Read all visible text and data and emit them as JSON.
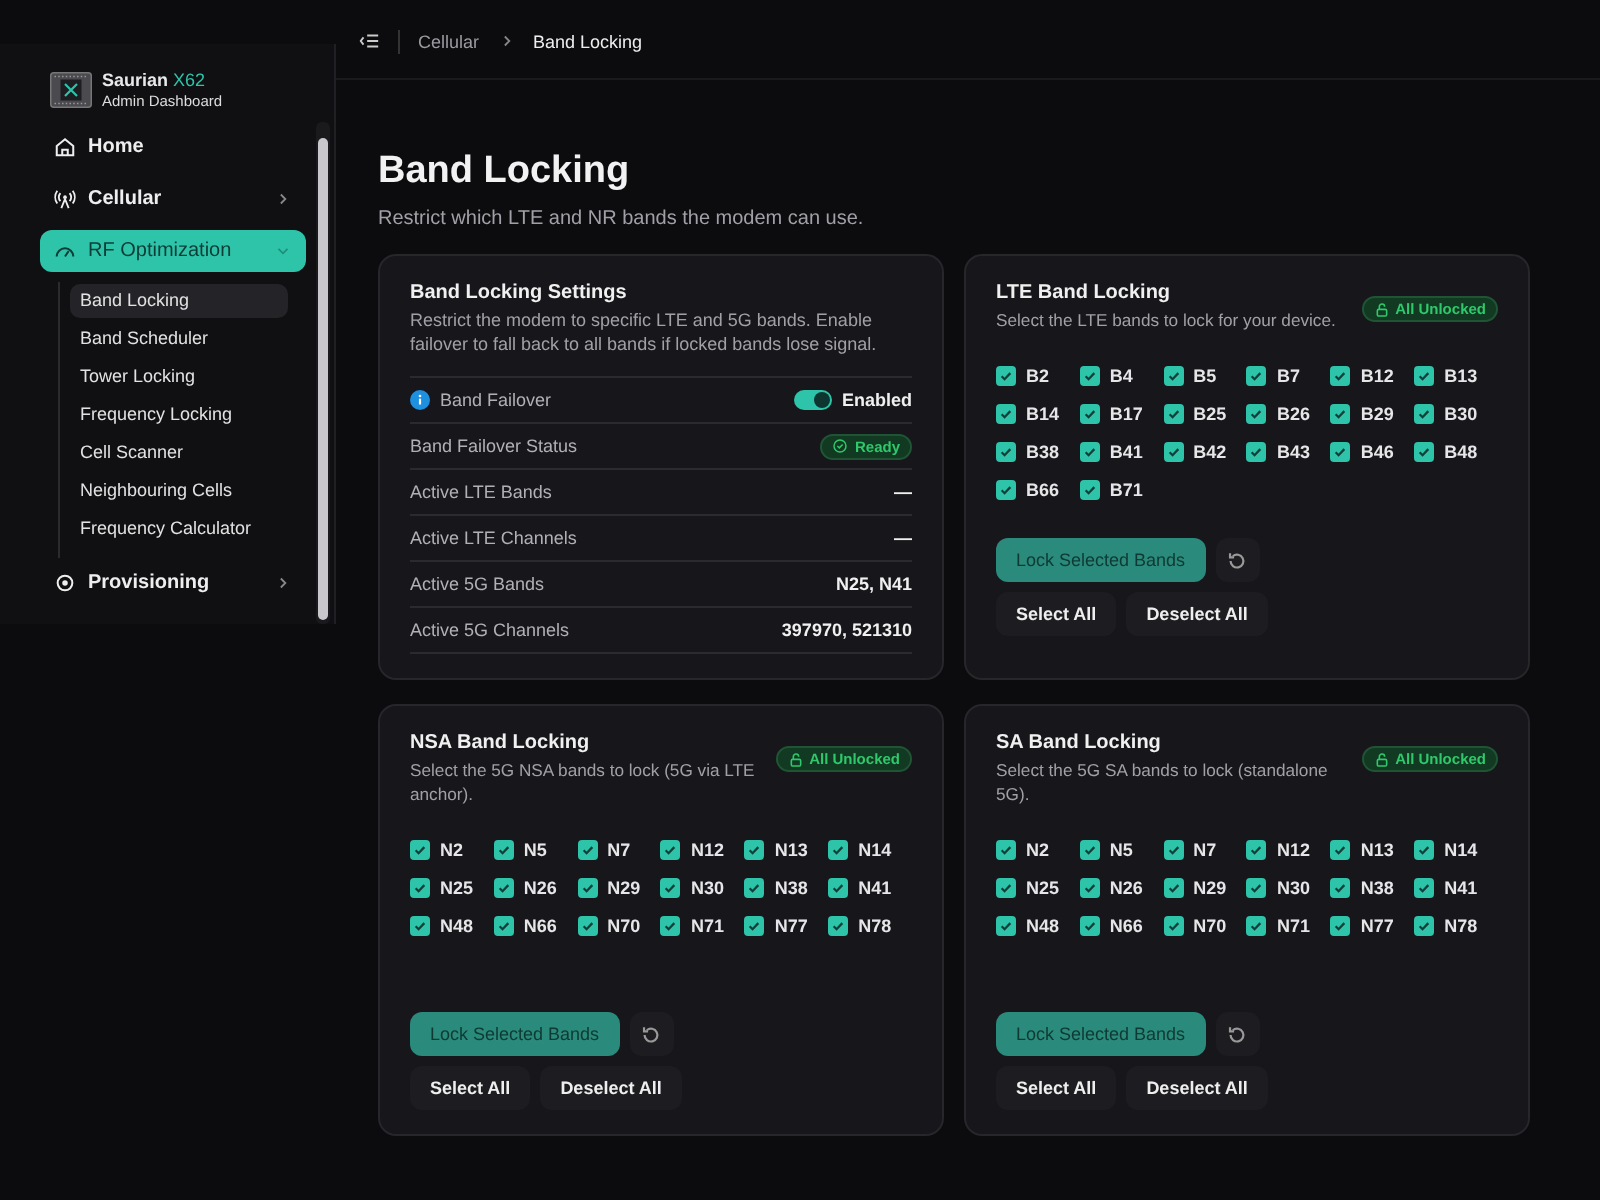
{
  "sidebar": {
    "brand": {
      "name": "Saurian",
      "accent": "X62",
      "subtitle": "Admin Dashboard"
    },
    "items": [
      {
        "label": "Home",
        "kind": "link",
        "selected": false
      },
      {
        "label": "Cellular",
        "kind": "group",
        "expanded": false,
        "selected": false
      },
      {
        "label": "RF Optimization",
        "kind": "group",
        "expanded": true,
        "selected": true,
        "children": [
          {
            "label": "Band Locking",
            "selected": true
          },
          {
            "label": "Band Scheduler",
            "selected": false
          },
          {
            "label": "Tower Locking",
            "selected": false
          },
          {
            "label": "Frequency Locking",
            "selected": false
          },
          {
            "label": "Cell Scanner",
            "selected": false
          },
          {
            "label": "Neighbouring Cells",
            "selected": false
          },
          {
            "label": "Frequency Calculator",
            "selected": false
          }
        ]
      },
      {
        "label": "Provisioning",
        "kind": "group",
        "expanded": false,
        "selected": false
      }
    ]
  },
  "breadcrumb": [
    "Cellular",
    "Band Locking"
  ],
  "page": {
    "title": "Band Locking",
    "subtitle": "Restrict which LTE and NR bands the modem can use."
  },
  "settings": {
    "title": "Band Locking Settings",
    "description": "Restrict the modem to specific LTE and 5G bands. Enable failover to fall back to all bands if locked bands lose signal.",
    "rows": [
      {
        "kind": "toggle",
        "label": "Band Failover",
        "on": true,
        "value": "Enabled"
      },
      {
        "kind": "status",
        "label": "Band Failover Status",
        "value": "Ready"
      },
      {
        "kind": "value",
        "label": "Active LTE Bands",
        "value": "—"
      },
      {
        "kind": "value",
        "label": "Active LTE Channels",
        "value": "—"
      },
      {
        "kind": "value",
        "label": "Active 5G Bands",
        "value": "N25, N41"
      },
      {
        "kind": "value",
        "label": "Active 5G Channels",
        "value": "397970, 521310"
      }
    ]
  },
  "band_cards": [
    {
      "title": "LTE Band Locking",
      "description": "Select the LTE bands to lock for your device.",
      "badge": "All Unlocked",
      "lock_button": "Lock Selected Bands",
      "select_all": "Select All",
      "deselect_all": "Deselect All",
      "bands": [
        {
          "label": "B2",
          "checked": true
        },
        {
          "label": "B4",
          "checked": true
        },
        {
          "label": "B5",
          "checked": true
        },
        {
          "label": "B7",
          "checked": true
        },
        {
          "label": "B12",
          "checked": true
        },
        {
          "label": "B13",
          "checked": true
        },
        {
          "label": "B14",
          "checked": true
        },
        {
          "label": "B17",
          "checked": true
        },
        {
          "label": "B25",
          "checked": true
        },
        {
          "label": "B26",
          "checked": true
        },
        {
          "label": "B29",
          "checked": true
        },
        {
          "label": "B30",
          "checked": true
        },
        {
          "label": "B38",
          "checked": true
        },
        {
          "label": "B41",
          "checked": true
        },
        {
          "label": "B42",
          "checked": true
        },
        {
          "label": "B43",
          "checked": true
        },
        {
          "label": "B46",
          "checked": true
        },
        {
          "label": "B48",
          "checked": true
        },
        {
          "label": "B66",
          "checked": true
        },
        {
          "label": "B71",
          "checked": true
        }
      ]
    },
    {
      "title": "NSA Band Locking",
      "description": "Select the 5G NSA bands to lock (5G via LTE anchor).",
      "badge": "All Unlocked",
      "lock_button": "Lock Selected Bands",
      "select_all": "Select All",
      "deselect_all": "Deselect All",
      "bands": [
        {
          "label": "N2",
          "checked": true
        },
        {
          "label": "N5",
          "checked": true
        },
        {
          "label": "N7",
          "checked": true
        },
        {
          "label": "N12",
          "checked": true
        },
        {
          "label": "N13",
          "checked": true
        },
        {
          "label": "N14",
          "checked": true
        },
        {
          "label": "N25",
          "checked": true
        },
        {
          "label": "N26",
          "checked": true
        },
        {
          "label": "N29",
          "checked": true
        },
        {
          "label": "N30",
          "checked": true
        },
        {
          "label": "N38",
          "checked": true
        },
        {
          "label": "N41",
          "checked": true
        },
        {
          "label": "N48",
          "checked": true
        },
        {
          "label": "N66",
          "checked": true
        },
        {
          "label": "N70",
          "checked": true
        },
        {
          "label": "N71",
          "checked": true
        },
        {
          "label": "N77",
          "checked": true
        },
        {
          "label": "N78",
          "checked": true
        }
      ]
    },
    {
      "title": "SA Band Locking",
      "description": "Select the 5G SA bands to lock (standalone 5G).",
      "badge": "All Unlocked",
      "lock_button": "Lock Selected Bands",
      "select_all": "Select All",
      "deselect_all": "Deselect All",
      "bands": [
        {
          "label": "N2",
          "checked": true
        },
        {
          "label": "N5",
          "checked": true
        },
        {
          "label": "N7",
          "checked": true
        },
        {
          "label": "N12",
          "checked": true
        },
        {
          "label": "N13",
          "checked": true
        },
        {
          "label": "N14",
          "checked": true
        },
        {
          "label": "N25",
          "checked": true
        },
        {
          "label": "N26",
          "checked": true
        },
        {
          "label": "N29",
          "checked": true
        },
        {
          "label": "N30",
          "checked": true
        },
        {
          "label": "N38",
          "checked": true
        },
        {
          "label": "N41",
          "checked": true
        },
        {
          "label": "N48",
          "checked": true
        },
        {
          "label": "N66",
          "checked": true
        },
        {
          "label": "N70",
          "checked": true
        },
        {
          "label": "N71",
          "checked": true
        },
        {
          "label": "N77",
          "checked": true
        },
        {
          "label": "N78",
          "checked": true
        }
      ]
    }
  ]
}
